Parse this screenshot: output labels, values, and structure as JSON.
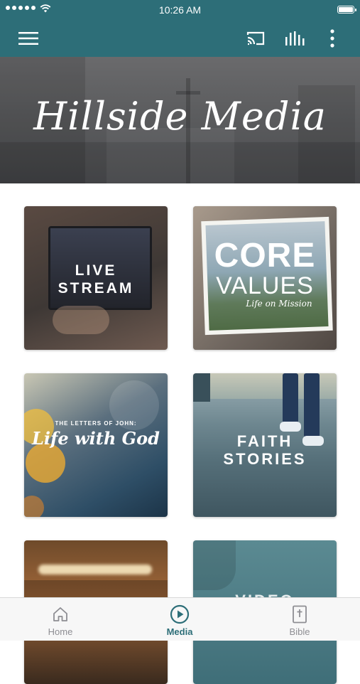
{
  "status": {
    "time": "10:26 AM"
  },
  "app_bar": {
    "icons": {
      "menu": "hamburger-menu-icon",
      "cast": "cast-icon",
      "stats": "equalizer-icon",
      "more": "more-vertical-icon"
    }
  },
  "hero": {
    "title": "Hillside Media"
  },
  "tiles": [
    {
      "line1": "LIVE",
      "line2": "STREAM"
    },
    {
      "line1": "CORE",
      "line2": "VALUES",
      "tagline": "Life on Mission"
    },
    {
      "kicker": "THE LETTERS OF JOHN:",
      "title": "Life with God"
    },
    {
      "line1": "FAITH",
      "line2": "STORIES"
    },
    {
      "image": "candles"
    },
    {
      "partial_text": "VIDEO"
    }
  ],
  "tabs": [
    {
      "label": "Home",
      "icon": "home-icon",
      "active": false
    },
    {
      "label": "Media",
      "icon": "play-circle-icon",
      "active": true
    },
    {
      "label": "Bible",
      "icon": "bible-icon",
      "active": false
    }
  ],
  "colors": {
    "brand": "#2d6e78",
    "tab_active": "#2d6e78",
    "tab_inactive": "#8e8e93"
  }
}
